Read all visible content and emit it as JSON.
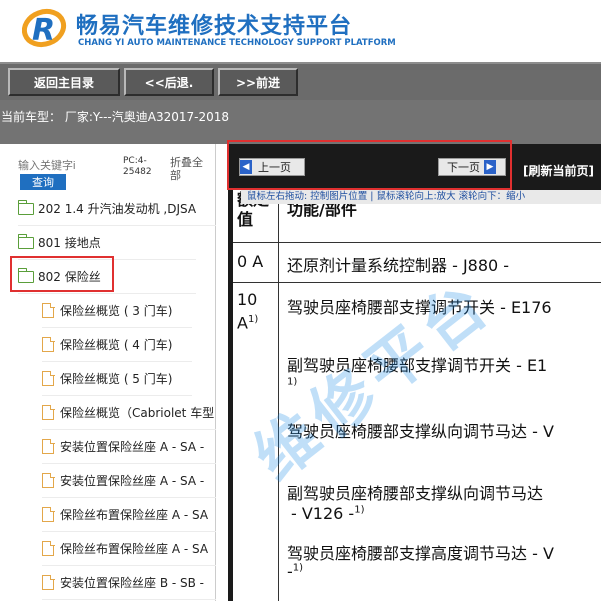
{
  "header": {
    "title": "畅易汽车维修技术支持平台",
    "subtitle": "CHANG YI AUTO MAINTENANCE TECHNOLOGY SUPPORT PLATFORM",
    "logo_icon": "cy-logo"
  },
  "toolbar": {
    "home_label": "返回主目录",
    "back_label": "<<后退.",
    "forward_label": ">>前进"
  },
  "vehicle": {
    "text": "当前车型：  厂家:Y---汽奥迪A32017-2018"
  },
  "sidebar": {
    "search_placeholder": "输入关键字i",
    "search_button": "查询",
    "pc_label": "PC:4-25482",
    "collapse_label": "折叠全部",
    "items": [
      {
        "label": "202 1.4 升汽油发动机 ,DJSA",
        "type": "folder"
      },
      {
        "label": "801 接地点",
        "type": "folder"
      },
      {
        "label": "802 保险丝",
        "type": "folder-open"
      },
      {
        "label": "保险丝概览 ( 3 门车)",
        "type": "doc"
      },
      {
        "label": "保险丝概览 ( 4 门车)",
        "type": "doc"
      },
      {
        "label": "保险丝概览 ( 5 门车)",
        "type": "doc"
      },
      {
        "label": "保险丝概览（Cabriolet 车型",
        "type": "doc"
      },
      {
        "label": "安装位置保险丝座 A - SA -",
        "type": "doc"
      },
      {
        "label": "安装位置保险丝座 A - SA -",
        "type": "doc"
      },
      {
        "label": "保险丝布置保险丝座 A - SA",
        "type": "doc"
      },
      {
        "label": "保险丝布置保险丝座 A - SA",
        "type": "doc"
      },
      {
        "label": "安装位置保险丝座 B - SB -",
        "type": "doc"
      }
    ]
  },
  "viewer": {
    "prev_label": "上一页",
    "next_label": "下一页",
    "refresh_label": "[刷新当前页]",
    "hint": "鼠标左右拖动: 控制图片位置 | 鼠标滚轮向上:放大  滚轮向下：缩小",
    "col_header_left": "额定值",
    "col_header_right": "功能/部件",
    "rows": [
      {
        "value": "0 A",
        "parts": [
          "还原剂计量系统控制器 - J880 -"
        ]
      },
      {
        "value": "10 A",
        "value_sup": "1)",
        "parts": [
          "驾驶员座椅腰部支撑调节开关 - E176",
          "副驾驶员座椅腰部支撑调节开关 - E1",
          "驾驶员座椅腰部支撑纵向调节马达 - V",
          "副驾驶员座椅腰部支撑纵向调节马达",
          "- V126 -",
          "驾驶员座椅腰部支撑高度调节马达 - V",
          "-"
        ]
      }
    ]
  },
  "watermark": "维修平台",
  "colors": {
    "brand_blue": "#1f6fc0",
    "toolbar_gray": "#6b6b6b",
    "highlight_red": "#e03030",
    "folder_green": "#5a9e3a",
    "doc_orange": "#e3a74a"
  }
}
